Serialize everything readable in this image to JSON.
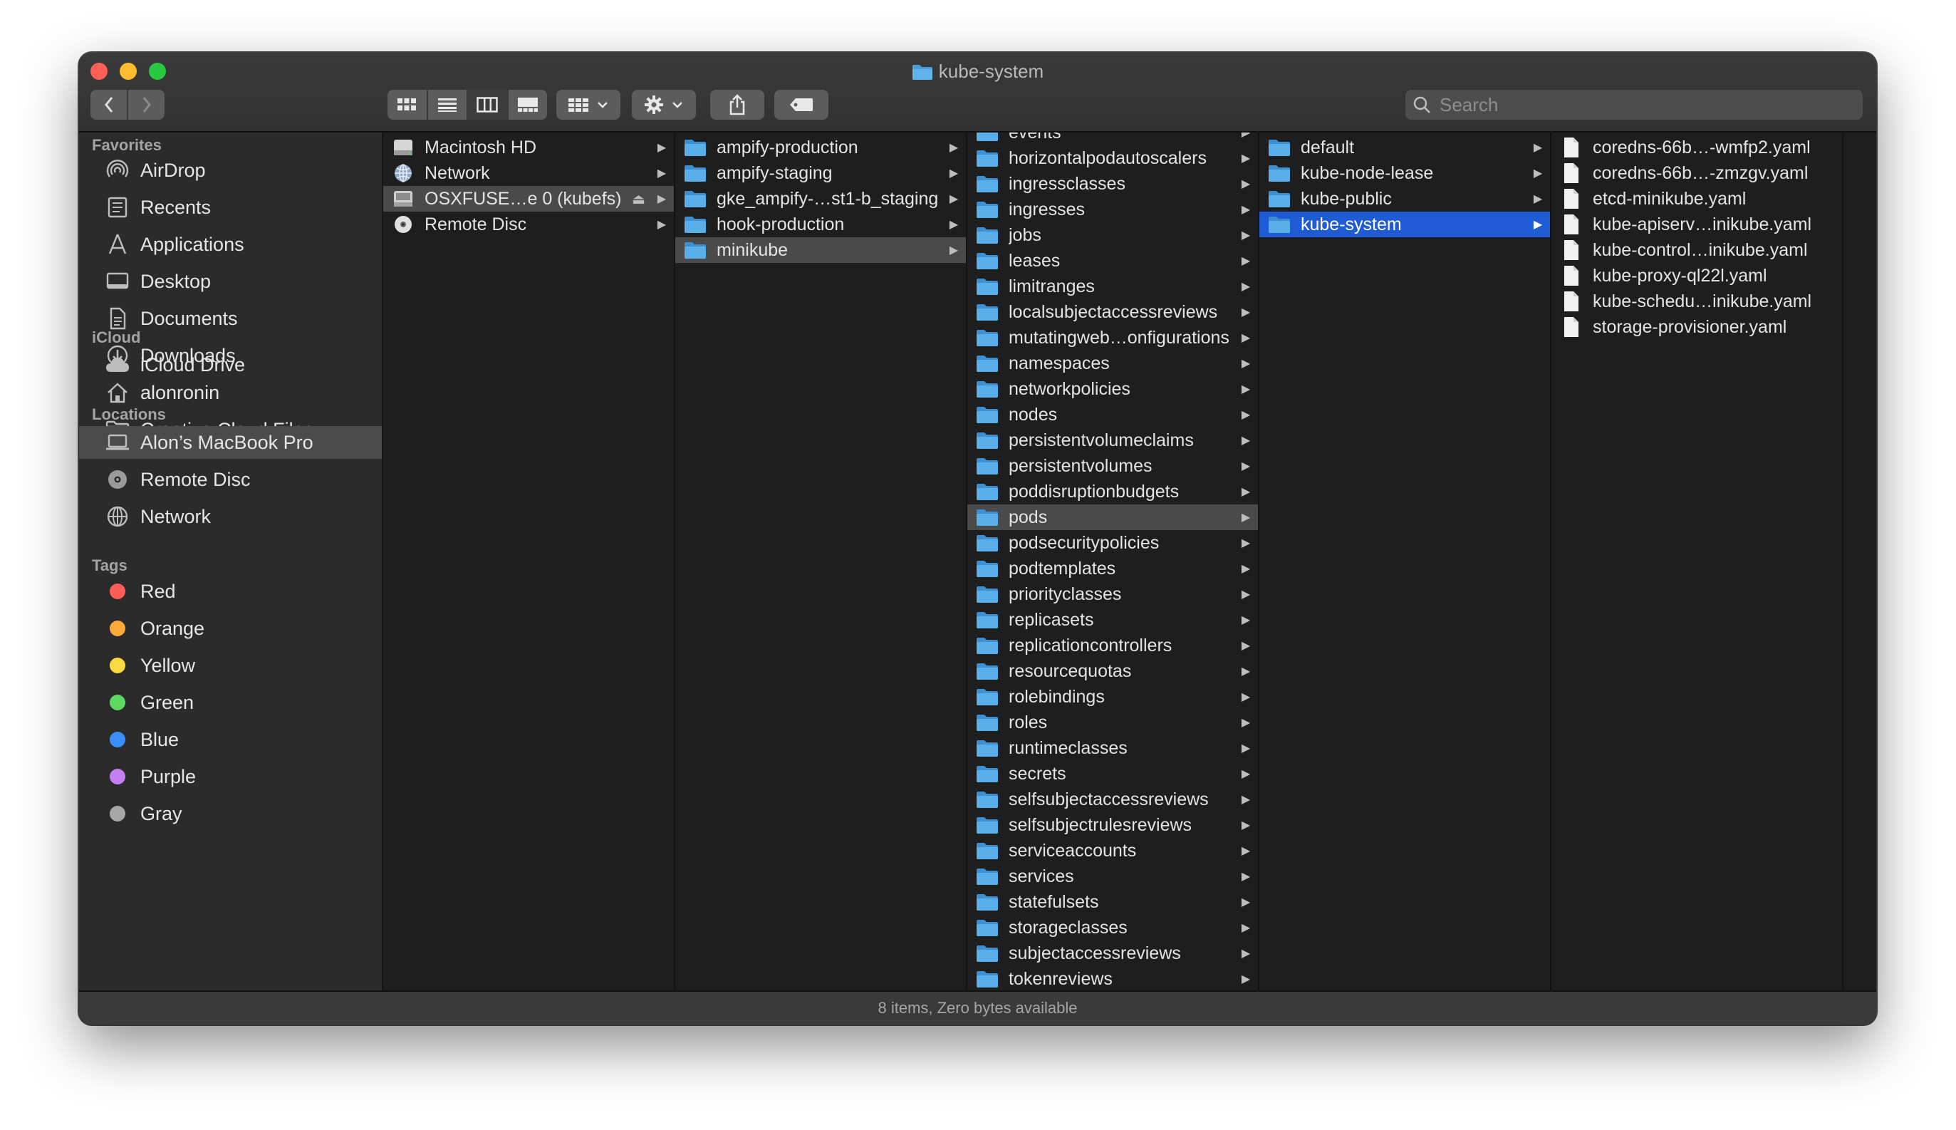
{
  "window": {
    "title": "kube-system"
  },
  "search": {
    "placeholder": "Search"
  },
  "sidebar": {
    "favorites_header": "Favorites",
    "favorites": [
      {
        "label": "AirDrop",
        "icon": "airdrop-icon"
      },
      {
        "label": "Recents",
        "icon": "clock-icon"
      },
      {
        "label": "Applications",
        "icon": "applications-icon"
      },
      {
        "label": "Desktop",
        "icon": "desktop-icon"
      },
      {
        "label": "Documents",
        "icon": "document-icon"
      },
      {
        "label": "Downloads",
        "icon": "download-icon"
      },
      {
        "label": "alonronin",
        "icon": "home-icon"
      },
      {
        "label": "Creative Cloud Files",
        "icon": "folder-icon"
      }
    ],
    "icloud_header": "iCloud",
    "icloud": [
      {
        "label": "iCloud Drive",
        "icon": "cloud-icon"
      }
    ],
    "locations_header": "Locations",
    "locations": [
      {
        "label": "Alon’s MacBook Pro",
        "icon": "laptop-icon",
        "selected": true
      },
      {
        "label": "Remote Disc",
        "icon": "disc-icon"
      },
      {
        "label": "Network",
        "icon": "globe-icon"
      }
    ],
    "tags_header": "Tags",
    "tags": [
      {
        "label": "Red",
        "color": "#fd5e55"
      },
      {
        "label": "Orange",
        "color": "#fcab3a"
      },
      {
        "label": "Yellow",
        "color": "#fbd942"
      },
      {
        "label": "Green",
        "color": "#5dd861"
      },
      {
        "label": "Blue",
        "color": "#3c8efc"
      },
      {
        "label": "Purple",
        "color": "#c67ff0"
      },
      {
        "label": "Gray",
        "color": "#a6a6a6"
      }
    ]
  },
  "columns": {
    "col1": [
      {
        "label": "Macintosh HD",
        "icon": "hard-drive-icon"
      },
      {
        "label": "Network",
        "icon": "globe-icon"
      },
      {
        "label": "OSXFUSE…e 0 (kubefs)",
        "icon": "volume-icon",
        "eject": "⏏"
      },
      {
        "label": "Remote Disc",
        "icon": "disc-icon"
      }
    ],
    "col2": [
      {
        "label": "ampify-production"
      },
      {
        "label": "ampify-staging"
      },
      {
        "label": "gke_ampify-…st1-b_staging"
      },
      {
        "label": "hook-production"
      },
      {
        "label": "minikube"
      }
    ],
    "col3": [
      {
        "label": "events"
      },
      {
        "label": "horizontalpodautoscalers"
      },
      {
        "label": "ingressclasses"
      },
      {
        "label": "ingresses"
      },
      {
        "label": "jobs"
      },
      {
        "label": "leases"
      },
      {
        "label": "limitranges"
      },
      {
        "label": "localsubjectaccessreviews"
      },
      {
        "label": "mutatingweb…onfigurations"
      },
      {
        "label": "namespaces"
      },
      {
        "label": "networkpolicies"
      },
      {
        "label": "nodes"
      },
      {
        "label": "persistentvolumeclaims"
      },
      {
        "label": "persistentvolumes"
      },
      {
        "label": "poddisruptionbudgets"
      },
      {
        "label": "pods"
      },
      {
        "label": "podsecuritypolicies"
      },
      {
        "label": "podtemplates"
      },
      {
        "label": "priorityclasses"
      },
      {
        "label": "replicasets"
      },
      {
        "label": "replicationcontrollers"
      },
      {
        "label": "resourcequotas"
      },
      {
        "label": "rolebindings"
      },
      {
        "label": "roles"
      },
      {
        "label": "runtimeclasses"
      },
      {
        "label": "secrets"
      },
      {
        "label": "selfsubjectaccessreviews"
      },
      {
        "label": "selfsubjectrulesreviews"
      },
      {
        "label": "serviceaccounts"
      },
      {
        "label": "services"
      },
      {
        "label": "statefulsets"
      },
      {
        "label": "storageclasses"
      },
      {
        "label": "subjectaccessreviews"
      },
      {
        "label": "tokenreviews"
      }
    ],
    "col4": [
      {
        "label": "default"
      },
      {
        "label": "kube-node-lease"
      },
      {
        "label": "kube-public"
      },
      {
        "label": "kube-system"
      }
    ],
    "col5": [
      {
        "label": "coredns-66b…-wmfp2.yaml"
      },
      {
        "label": "coredns-66b…-zmzgv.yaml"
      },
      {
        "label": "etcd-minikube.yaml"
      },
      {
        "label": "kube-apiserv…inikube.yaml"
      },
      {
        "label": "kube-control…inikube.yaml"
      },
      {
        "label": "kube-proxy-ql22l.yaml"
      },
      {
        "label": "kube-schedu…inikube.yaml"
      },
      {
        "label": "storage-provisioner.yaml"
      }
    ]
  },
  "status": {
    "text": "8 items, Zero bytes available"
  }
}
